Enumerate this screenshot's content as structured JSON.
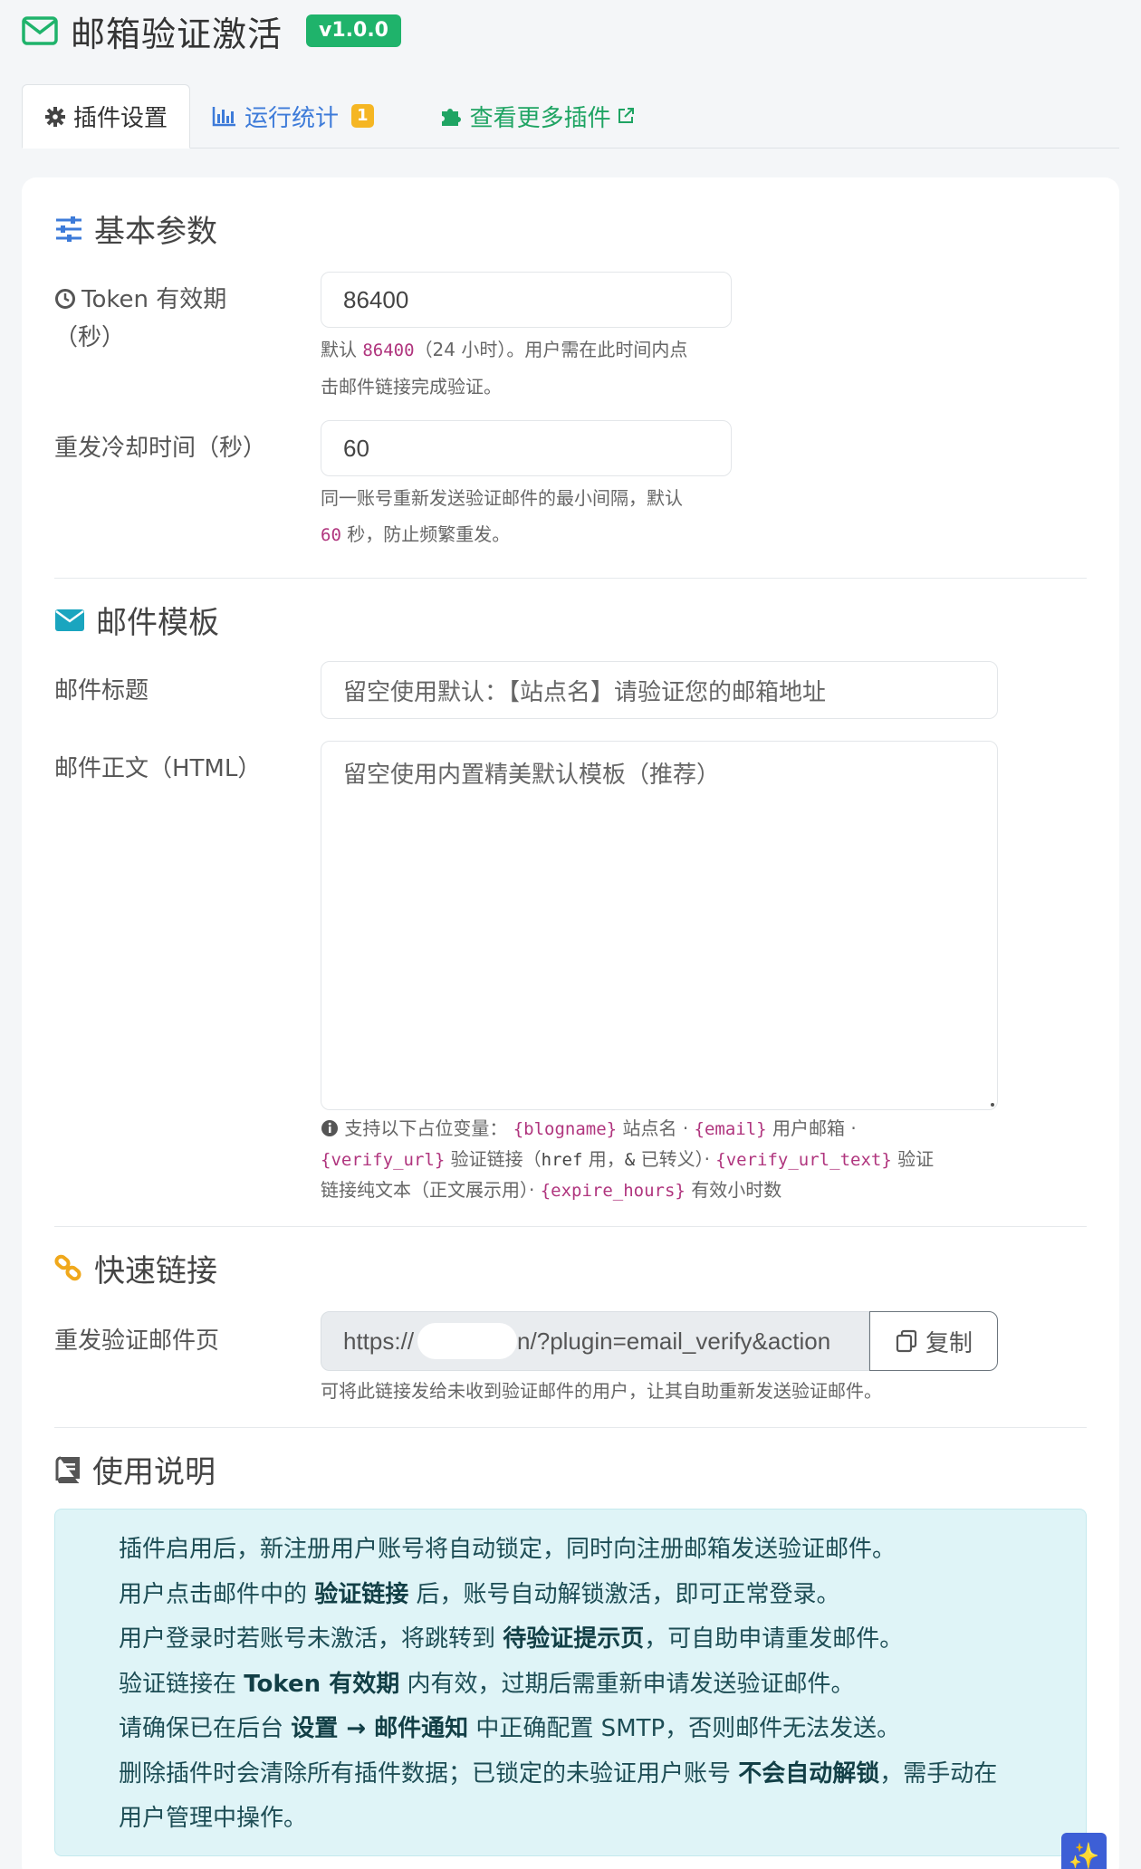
{
  "header": {
    "title": "邮箱验证激活",
    "version": "v1.0.0"
  },
  "tabs": [
    {
      "label": "插件设置"
    },
    {
      "label": "运行统计",
      "badge": "1"
    },
    {
      "label": "查看更多插件"
    }
  ],
  "basic": {
    "title": "基本参数",
    "token_label_1": "Token 有效期",
    "token_label_2": "（秒）",
    "token_value": "86400",
    "token_help_a": "默认 ",
    "token_help_code": "86400",
    "token_help_b": "（24 小时）。用户需在此时间内点",
    "token_help_c": "击邮件链接完成验证。",
    "cooldown_label": "重发冷却时间（秒）",
    "cooldown_value": "60",
    "cooldown_help_a": "同一账号重新发送验证邮件的最小间隔，默认",
    "cooldown_help_code": "60",
    "cooldown_help_b": " 秒，防止频繁重发。"
  },
  "template": {
    "title": "邮件模板",
    "subject_label": "邮件标题",
    "subject_placeholder": "留空使用默认：【站点名】请验证您的邮箱地址",
    "body_label": "邮件正文（HTML）",
    "body_placeholder": "留空使用内置精美默认模板（推荐）",
    "vars_intro": "支持以下占位变量：",
    "var1": "{blogname}",
    "var1_desc": " 站点名 · ",
    "var2": "{email}",
    "var2_desc": " 用户邮箱 · ",
    "var3": "{verify_url}",
    "var3_desc_a": " 验证链接（",
    "var3_href": "href",
    "var3_desc_b": " 用，",
    "var3_amp": "&",
    "var3_desc_c": " 已转义）· ",
    "var4": "{verify_url_text}",
    "var4_desc_a": " 验证",
    "var4_desc_b": "链接纯文本（正文展示用）· ",
    "var5": "{expire_hours}",
    "var5_desc": " 有效小时数"
  },
  "quick_links": {
    "title": "快速链接",
    "resend_label": "重发验证邮件页",
    "url_prefix": "https://",
    "url_suffix": "n/?plugin=email_verify&action",
    "copy_label": "复制",
    "help": "可将此链接发给未收到验证邮件的用户，让其自助重新发送验证邮件。"
  },
  "usage": {
    "title": "使用说明",
    "l1": "插件启用后，新注册用户账号将自动锁定，同时向注册邮箱发送验证邮件。",
    "l2_a": "用户点击邮件中的 ",
    "l2_b": "验证链接",
    "l2_c": " 后，账号自动解锁激活，即可正常登录。",
    "l3_a": "用户登录时若账号未激活，将跳转到 ",
    "l3_b": "待验证提示页",
    "l3_c": "，可自助申请重发邮件。",
    "l4_a": "验证链接在 ",
    "l4_b": "Token 有效期",
    "l4_c": " 内有效，过期后需重新申请发送验证邮件。",
    "l5_a": "请确保已在后台 ",
    "l5_b": "设置 → 邮件通知",
    "l5_c": " 中正确配置 SMTP，否则邮件无法发送。",
    "l6_a": "删除插件时会清除所有插件数据；已锁定的未验证用户账号 ",
    "l6_b": "不会自动解锁",
    "l6_c": "，需手动在",
    "l6_d": "用户管理中操作。"
  },
  "fab": {
    "glyph": "✨"
  },
  "colors": {
    "accent_green": "#1fb36b",
    "link_blue": "#3d7bd9",
    "badge_yellow": "#f5b623",
    "code_pink": "#b0357e",
    "info_bg": "#dff4f7"
  }
}
